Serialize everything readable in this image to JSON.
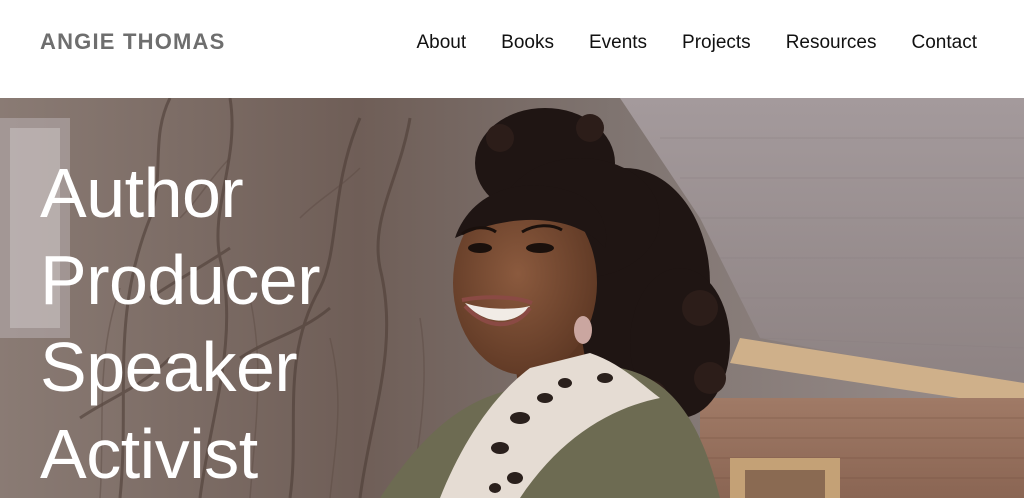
{
  "site": {
    "logo": "ANGIE THOMAS"
  },
  "nav": {
    "items": [
      {
        "label": "About"
      },
      {
        "label": "Books"
      },
      {
        "label": "Events"
      },
      {
        "label": "Projects"
      },
      {
        "label": "Resources"
      },
      {
        "label": "Contact"
      }
    ]
  },
  "hero": {
    "lines": [
      "Author",
      "Producer",
      "Speaker",
      "Activist"
    ],
    "image": "author-portrait-photo"
  },
  "colors": {
    "logo": "#6e6e6e",
    "nav_text": "#111111",
    "hero_text": "#ffffff",
    "header_bg": "#ffffff"
  }
}
